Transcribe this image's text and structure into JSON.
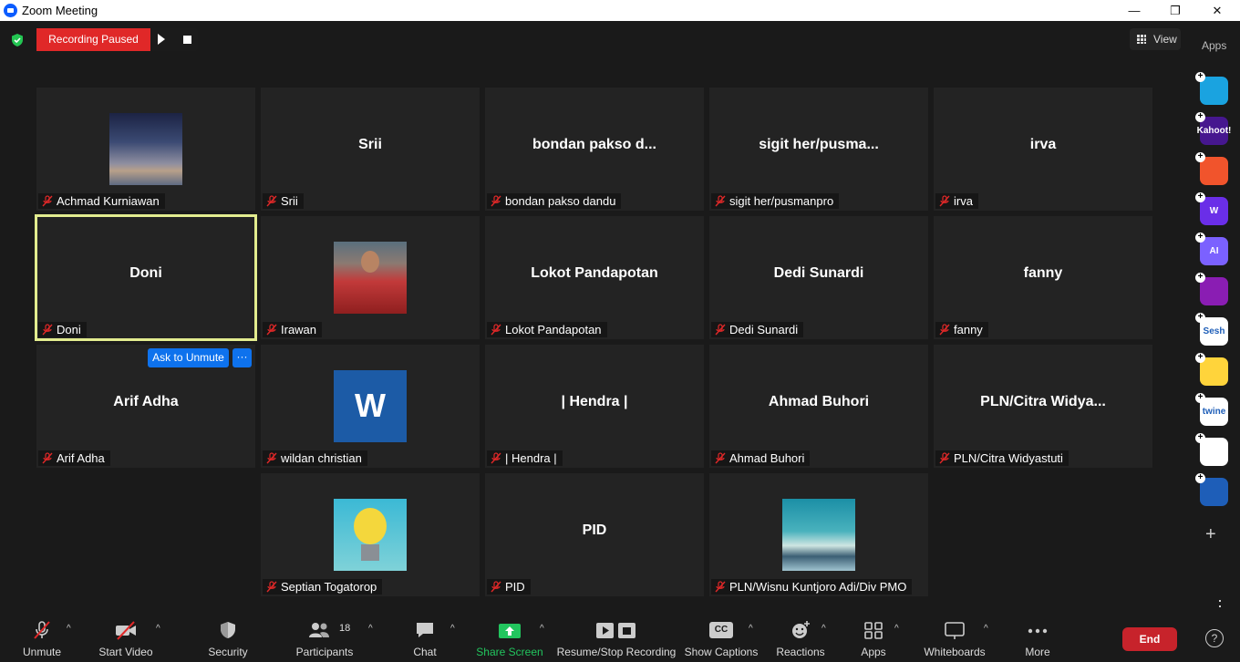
{
  "window": {
    "title": "Zoom Meeting",
    "minimize": "—",
    "maximize": "❐",
    "close": "✕"
  },
  "recording": {
    "status_label": "Recording Paused"
  },
  "view_button": {
    "label": "View"
  },
  "apps_label": "Apps",
  "tiles": [
    {
      "display": "",
      "name": "Achmad Kurniawan"
    },
    {
      "display": "Srii",
      "name": "Srii"
    },
    {
      "display": "bondan pakso d...",
      "name": "bondan pakso dandu"
    },
    {
      "display": "sigit her/pusma...",
      "name": "sigit her/pusmanpro"
    },
    {
      "display": "irva",
      "name": "irva"
    },
    {
      "display": "Doni",
      "name": "Doni"
    },
    {
      "display": "",
      "name": "Irawan"
    },
    {
      "display": "Lokot Pandapotan",
      "name": "Lokot Pandapotan"
    },
    {
      "display": "Dedi Sunardi",
      "name": "Dedi Sunardi"
    },
    {
      "display": "fanny",
      "name": "fanny"
    },
    {
      "display": "Arif Adha",
      "name": "Arif Adha"
    },
    {
      "display": "W",
      "name": "wildan christian"
    },
    {
      "display": "| Hendra |",
      "name": "| Hendra |"
    },
    {
      "display": "Ahmad Buhori",
      "name": "Ahmad Buhori"
    },
    {
      "display": "PLN/Citra  Widya...",
      "name": "PLN/Citra Widyastuti"
    },
    {
      "display": "",
      "name": "Septian Togatorop"
    },
    {
      "display": "PID",
      "name": "PID"
    },
    {
      "display": "",
      "name": "PLN/Wisnu Kuntjoro Adi/Div PMO"
    }
  ],
  "ask_to_unmute": {
    "label": "Ask to Unmute",
    "more": "···"
  },
  "side_apps": [
    {
      "icon": "pitch-app-icon",
      "text": "",
      "color": "#1aa3e0"
    },
    {
      "icon": "kahoot-app-icon",
      "text": "Kahoot!",
      "color": "#46178f"
    },
    {
      "icon": "app-icon-orange",
      "text": "",
      "color": "#f1542c"
    },
    {
      "icon": "wooclap-app-icon",
      "text": "W",
      "color": "#6a2ee8"
    },
    {
      "icon": "ai-app-icon",
      "text": "AI",
      "color": "#7b61ff"
    },
    {
      "icon": "app-icon-purple",
      "text": "",
      "color": "#8a1db3"
    },
    {
      "icon": "sesh-app-icon",
      "text": "Sesh",
      "color": "#ffffff"
    },
    {
      "icon": "emoji-app-icon",
      "text": "",
      "color": "#ffd43b"
    },
    {
      "icon": "twine-app-icon",
      "text": "twine",
      "color": "#ffffff"
    },
    {
      "icon": "app-icon-tiles",
      "text": "",
      "color": "#ffffff"
    },
    {
      "icon": "sync-app-icon",
      "text": "",
      "color": "#1e5eb8"
    }
  ],
  "add_app": "+",
  "more_kebab": "⋮",
  "toolbar": {
    "unmute": "Unmute",
    "start_video": "Start Video",
    "security": "Security",
    "participants": "Participants",
    "participants_count": "18",
    "chat": "Chat",
    "share_screen": "Share Screen",
    "recording": "Resume/Stop Recording",
    "captions": "Show Captions",
    "reactions": "Reactions",
    "apps": "Apps",
    "whiteboards": "Whiteboards",
    "more": "More",
    "end": "End",
    "help": "?",
    "caret": "^",
    "cc": "CC"
  },
  "colors": {
    "recording_red": "#e02828",
    "share_green": "#22c55e",
    "end_red": "#c7232b",
    "active_border": "#e2ec8f",
    "ask_blue": "#0e72ed"
  }
}
